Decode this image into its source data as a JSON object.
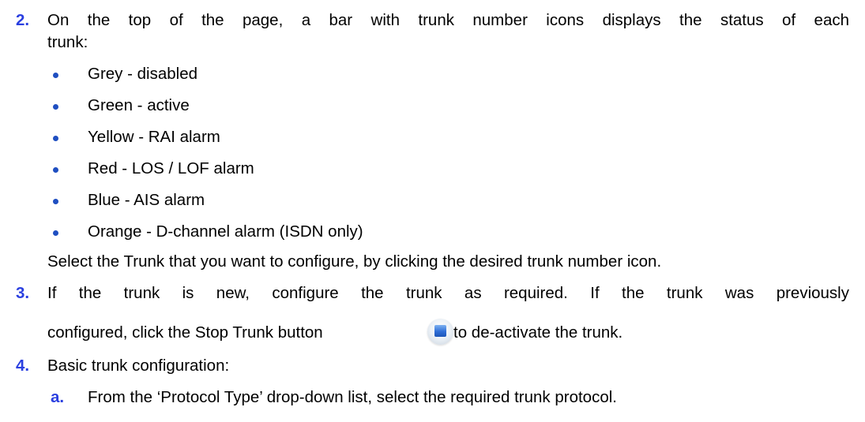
{
  "steps": [
    {
      "number": "2.",
      "line1": "On the top of the page, a bar with trunk number icons displays the status of each",
      "line2": "trunk:",
      "bullets": [
        "Grey - disabled",
        "Green - active",
        "Yellow - RAI alarm",
        "Red - LOS / LOF alarm",
        "Blue - AIS alarm",
        "Orange - D-channel alarm (ISDN only)"
      ],
      "after": "Select the Trunk that you want to configure, by clicking the desired trunk number icon."
    },
    {
      "number": "3.",
      "line1": "If the trunk is new, configure the trunk as required. If the trunk was previously",
      "line2_before": "configured, click the Stop Trunk button",
      "line2_after": "to de-activate the trunk.",
      "icon": "stop-trunk-icon"
    },
    {
      "number": "4.",
      "text": "Basic trunk configuration:",
      "substeps": [
        {
          "letter": "a.",
          "text": "From the ‘Protocol Type’ drop-down list, select the required trunk protocol."
        }
      ]
    }
  ]
}
